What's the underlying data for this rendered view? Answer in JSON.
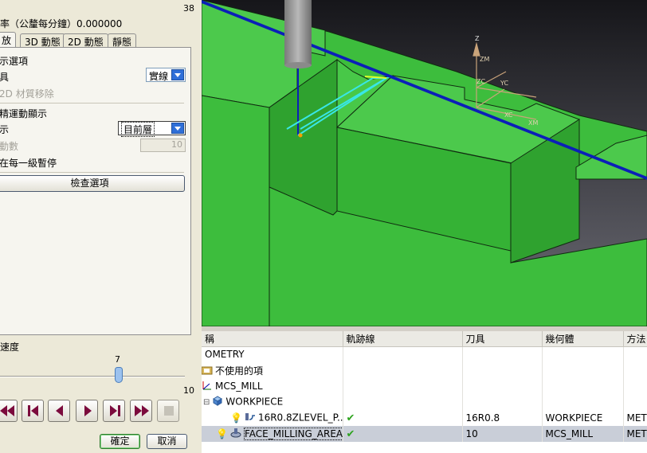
{
  "dialog": {
    "top_number": "38",
    "feed_rate_label": "率（公釐每分鐘）0.000000",
    "tabs": [
      {
        "label": "放",
        "active": true
      },
      {
        "label": "3D 動態",
        "active": false
      },
      {
        "label": "2D 動態",
        "active": false
      },
      {
        "label": "靜態",
        "active": false
      }
    ],
    "display_options_heading": "示選項",
    "tool_label": "具",
    "tool_value": "實線",
    "material_removal_label": "2D 材質移除",
    "motion_display_heading": "精運動顯示",
    "display_label": "示",
    "display_value": "目前層",
    "moves_label": "動數",
    "moves_value": "10",
    "pause_label": "在每一級暫停",
    "check_options_button": "檢查選項",
    "speed_label": "速度",
    "speed_value": "7",
    "speed_max": "10",
    "speed_fraction": 0.7,
    "ok_button": "確定",
    "cancel_button": "取消"
  },
  "navigator": {
    "columns": [
      "稱",
      "軌跡線",
      "刀具",
      "幾何體",
      "方法"
    ],
    "rows": [
      {
        "name": "OMETRY",
        "path": "",
        "tool": "",
        "geometry": "",
        "method": "",
        "icon": "none",
        "check": false,
        "selected": false,
        "indent": 0
      },
      {
        "name": "不使用的項",
        "path": "",
        "tool": "",
        "geometry": "",
        "method": "",
        "icon": "folder-icon",
        "check": false,
        "selected": false,
        "indent": 0
      },
      {
        "name": "MCS_MILL",
        "path": "",
        "tool": "",
        "geometry": "",
        "method": "",
        "icon": "mcs-icon",
        "check": false,
        "selected": false,
        "indent": 0
      },
      {
        "name": "WORKPIECE",
        "path": "",
        "tool": "",
        "geometry": "",
        "method": "",
        "icon": "workpiece-icon",
        "check": false,
        "selected": false,
        "indent": 1
      },
      {
        "name": "16R0.8ZLEVEL_P...",
        "path": "✔",
        "tool": "16R0.8",
        "geometry": "WORKPIECE",
        "method": "METH",
        "icon": "zlevel-operation-icon",
        "check": true,
        "selected": false,
        "indent": 2
      },
      {
        "name": "FACE_MILLING_AREA",
        "path": "✔",
        "tool": "10",
        "geometry": "MCS_MILL",
        "method": "METH",
        "icon": "face-milling-operation-icon",
        "check": true,
        "selected": true,
        "indent": 1
      }
    ]
  },
  "viewport": {
    "axis_labels": [
      "Z",
      "ZM",
      "ZC",
      "YC",
      "XC",
      "XM"
    ],
    "colors": {
      "part": "#3dbd3d",
      "part_dark": "#2fa22f",
      "background_top": "#1c1c20",
      "toolpath": "#39e6e6",
      "path_line": "#0b1fb8"
    }
  },
  "icons": [
    "rewind-icon",
    "step-back-icon",
    "play-reverse-icon",
    "play-icon",
    "step-forward-icon",
    "fast-forward-icon",
    "stop-icon",
    "dropdown-arrow-icon",
    "check-icon"
  ]
}
